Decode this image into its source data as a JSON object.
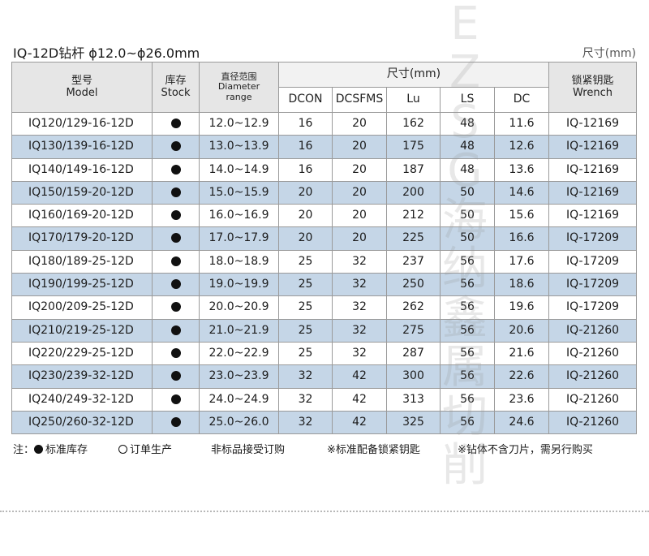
{
  "title": "IQ-12D钻杆  ϕ12.0~ϕ26.0mm",
  "unit_label": "尺寸(mm)",
  "header": {
    "model_cn": "型号",
    "model_en": "Model",
    "stock_cn": "库存",
    "stock_en": "Stock",
    "range_cn": "直径范围",
    "range_en_1": "Diameter",
    "range_en_2": "range",
    "dims_group": "尺寸(mm)",
    "dcon": "DCON",
    "dcsfms": "DCSFMS",
    "lu": "Lu",
    "ls": "LS",
    "dc": "DC",
    "wrench_cn": "锁紧钥匙",
    "wrench_en": "Wrench"
  },
  "rows": [
    {
      "model": "IQ120/129-16-12D",
      "stock": "in-stock",
      "range": "12.0~12.9",
      "dcon": "16",
      "dcsfms": "20",
      "lu": "162",
      "ls": "48",
      "dc": "11.6",
      "wrench": "IQ-12169"
    },
    {
      "model": "IQ130/139-16-12D",
      "stock": "in-stock",
      "range": "13.0~13.9",
      "dcon": "16",
      "dcsfms": "20",
      "lu": "175",
      "ls": "48",
      "dc": "12.6",
      "wrench": "IQ-12169"
    },
    {
      "model": "IQ140/149-16-12D",
      "stock": "in-stock",
      "range": "14.0~14.9",
      "dcon": "16",
      "dcsfms": "20",
      "lu": "187",
      "ls": "48",
      "dc": "13.6",
      "wrench": "IQ-12169"
    },
    {
      "model": "IQ150/159-20-12D",
      "stock": "in-stock",
      "range": "15.0~15.9",
      "dcon": "20",
      "dcsfms": "20",
      "lu": "200",
      "ls": "50",
      "dc": "14.6",
      "wrench": "IQ-12169"
    },
    {
      "model": "IQ160/169-20-12D",
      "stock": "in-stock",
      "range": "16.0~16.9",
      "dcon": "20",
      "dcsfms": "20",
      "lu": "212",
      "ls": "50",
      "dc": "15.6",
      "wrench": "IQ-12169"
    },
    {
      "model": "IQ170/179-20-12D",
      "stock": "in-stock",
      "range": "17.0~17.9",
      "dcon": "20",
      "dcsfms": "20",
      "lu": "225",
      "ls": "50",
      "dc": "16.6",
      "wrench": "IQ-17209"
    },
    {
      "model": "IQ180/189-25-12D",
      "stock": "in-stock",
      "range": "18.0~18.9",
      "dcon": "25",
      "dcsfms": "32",
      "lu": "237",
      "ls": "56",
      "dc": "17.6",
      "wrench": "IQ-17209"
    },
    {
      "model": "IQ190/199-25-12D",
      "stock": "in-stock",
      "range": "19.0~19.9",
      "dcon": "25",
      "dcsfms": "32",
      "lu": "250",
      "ls": "56",
      "dc": "18.6",
      "wrench": "IQ-17209"
    },
    {
      "model": "IQ200/209-25-12D",
      "stock": "in-stock",
      "range": "20.0~20.9",
      "dcon": "25",
      "dcsfms": "32",
      "lu": "262",
      "ls": "56",
      "dc": "19.6",
      "wrench": "IQ-17209"
    },
    {
      "model": "IQ210/219-25-12D",
      "stock": "in-stock",
      "range": "21.0~21.9",
      "dcon": "25",
      "dcsfms": "32",
      "lu": "275",
      "ls": "56",
      "dc": "20.6",
      "wrench": "IQ-21260"
    },
    {
      "model": "IQ220/229-25-12D",
      "stock": "in-stock",
      "range": "22.0~22.9",
      "dcon": "25",
      "dcsfms": "32",
      "lu": "287",
      "ls": "56",
      "dc": "21.6",
      "wrench": "IQ-21260"
    },
    {
      "model": "IQ230/239-32-12D",
      "stock": "in-stock",
      "range": "23.0~23.9",
      "dcon": "32",
      "dcsfms": "42",
      "lu": "300",
      "ls": "56",
      "dc": "22.6",
      "wrench": "IQ-21260"
    },
    {
      "model": "IQ240/249-32-12D",
      "stock": "in-stock",
      "range": "24.0~24.9",
      "dcon": "32",
      "dcsfms": "42",
      "lu": "313",
      "ls": "56",
      "dc": "23.6",
      "wrench": "IQ-21260"
    },
    {
      "model": "IQ250/260-32-12D",
      "stock": "in-stock",
      "range": "25.0~26.0",
      "dcon": "32",
      "dcsfms": "42",
      "lu": "325",
      "ls": "56",
      "dc": "24.6",
      "wrench": "IQ-21260"
    }
  ],
  "notes": {
    "prefix": "注：",
    "standard_stock": "标准库存",
    "made_to_order": "订单生产",
    "non_standard": "非标品接受订购",
    "wrench_note": "※标准配备锁紧钥匙",
    "insert_note": "※钻体不含刀片，需另行购买"
  },
  "icons": {
    "stock_marker": "filled-circle-icon",
    "order_marker": "hollow-circle-icon"
  },
  "colors": {
    "row_alt": "#c5d6e7",
    "header_bg": "#e6e6e6",
    "border": "#9a9a9a"
  },
  "watermark_chars": [
    "E",
    "Z",
    "S",
    "G",
    "海",
    "纳",
    "鑫",
    "属",
    "切",
    "削"
  ]
}
